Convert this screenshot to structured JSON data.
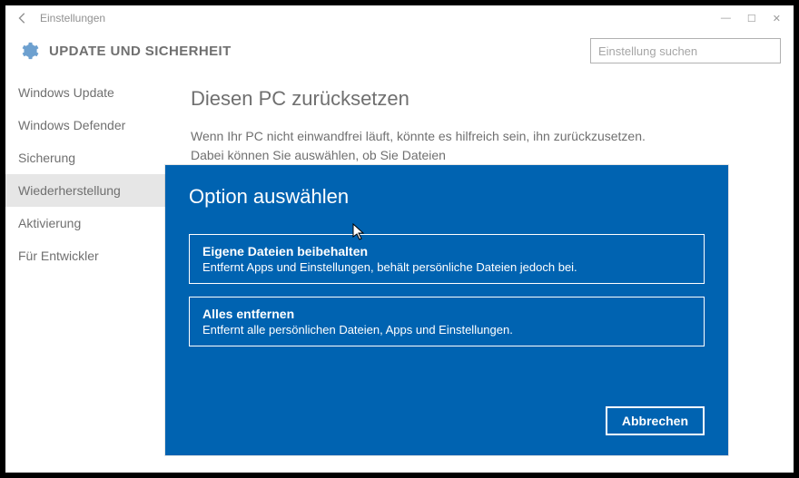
{
  "titlebar": {
    "title": "Einstellungen"
  },
  "header": {
    "title": "UPDATE UND SICHERHEIT"
  },
  "search": {
    "placeholder": "Einstellung suchen"
  },
  "sidebar": {
    "items": [
      {
        "label": "Windows Update"
      },
      {
        "label": "Windows Defender"
      },
      {
        "label": "Sicherung"
      },
      {
        "label": "Wiederherstellung"
      },
      {
        "label": "Aktivierung"
      },
      {
        "label": "Für Entwickler"
      }
    ],
    "selected_index": 3
  },
  "content": {
    "heading": "Diesen PC zurücksetzen",
    "paragraph": "Wenn Ihr PC nicht einwandfrei läuft, könnte es hilfreich sein, ihn zurückzusetzen. Dabei können Sie auswählen, ob Sie Dateien"
  },
  "dialog": {
    "title": "Option auswählen",
    "options": [
      {
        "title": "Eigene Dateien beibehalten",
        "desc": "Entfernt Apps und Einstellungen, behält persönliche Dateien jedoch bei."
      },
      {
        "title": "Alles entfernen",
        "desc": "Entfernt alle persönlichen Dateien, Apps und Einstellungen."
      }
    ],
    "cancel": "Abbrechen"
  }
}
